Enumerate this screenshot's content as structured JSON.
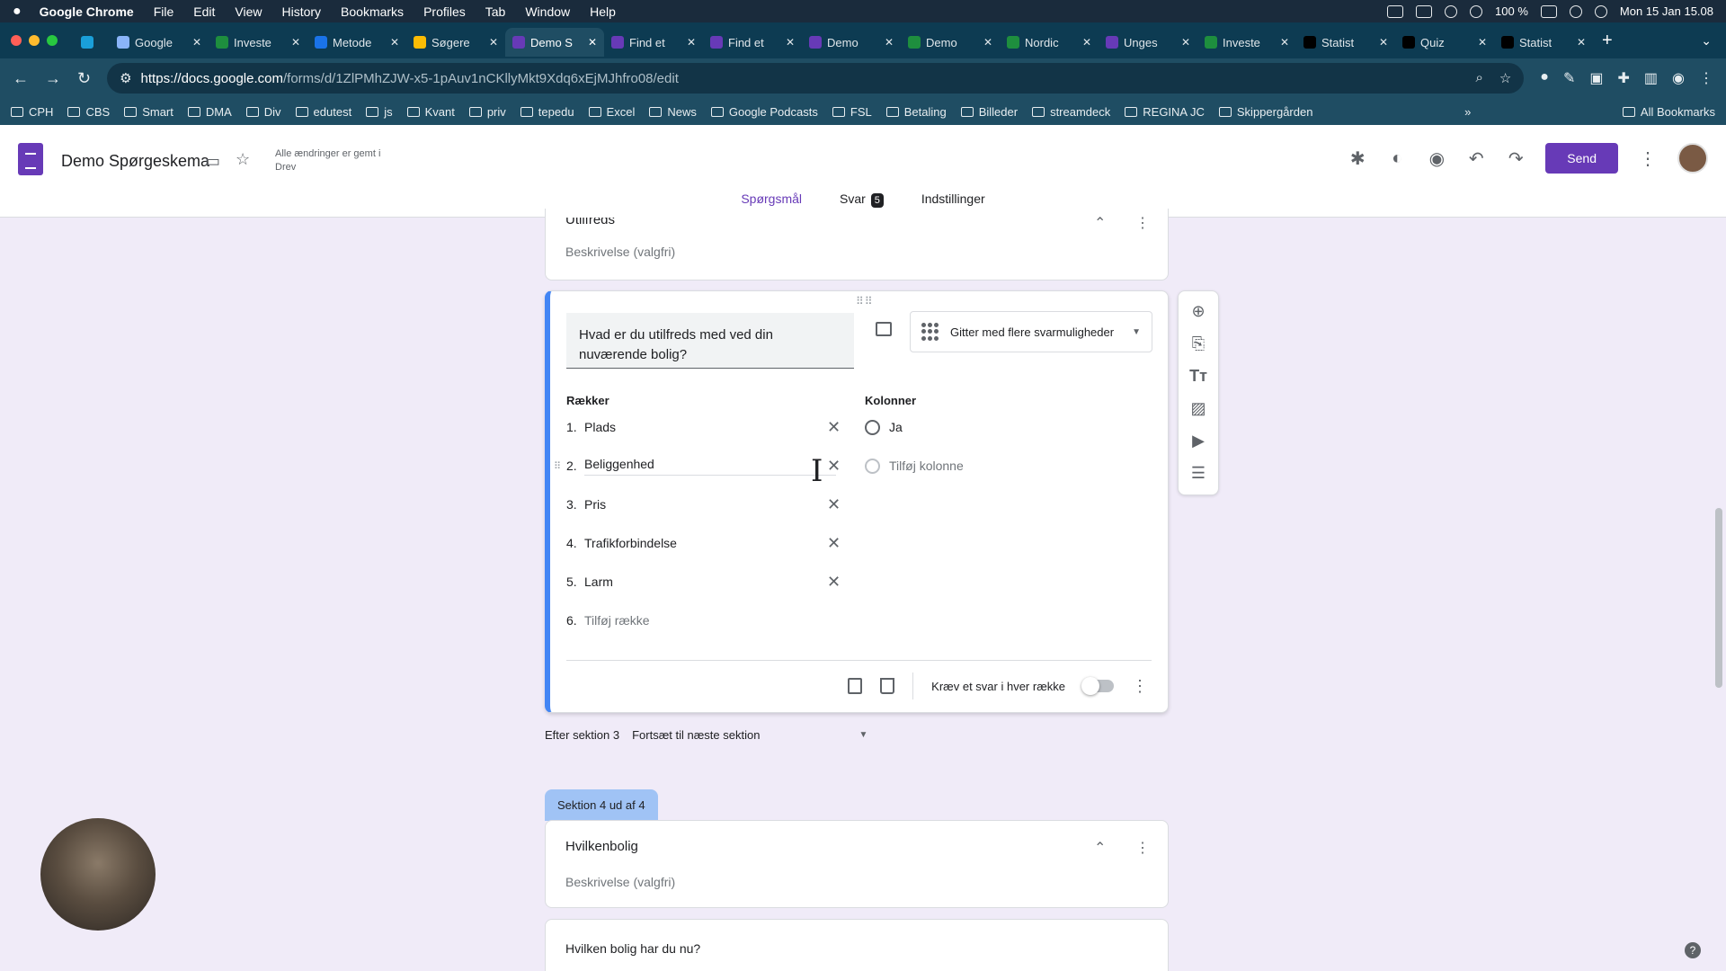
{
  "menubar": {
    "app": "Google Chrome",
    "items": [
      "File",
      "Edit",
      "View",
      "History",
      "Bookmarks",
      "Profiles",
      "Tab",
      "Window",
      "Help"
    ],
    "battery": "100 %",
    "clock": "Mon 15 Jan 15.08"
  },
  "tabs": [
    {
      "label": "Google",
      "color": "#8ab4f8"
    },
    {
      "label": "Investe",
      "color": "#1e8e3e"
    },
    {
      "label": "Metode",
      "color": "#1a73e8"
    },
    {
      "label": "Søgere",
      "color": "#fbbc04"
    },
    {
      "label": "Demo S",
      "color": "#673ab7",
      "active": true
    },
    {
      "label": "Find et",
      "color": "#673ab7"
    },
    {
      "label": "Find et",
      "color": "#673ab7"
    },
    {
      "label": "Demo",
      "color": "#673ab7"
    },
    {
      "label": "Demo",
      "color": "#1e8e3e"
    },
    {
      "label": "Nordic",
      "color": "#1e8e3e"
    },
    {
      "label": "Unges",
      "color": "#673ab7"
    },
    {
      "label": "Investe",
      "color": "#1e8e3e"
    },
    {
      "label": "Statist",
      "color": "#000000"
    },
    {
      "label": "Quiz",
      "color": "#000000"
    },
    {
      "label": "Statist",
      "color": "#000000"
    }
  ],
  "url": {
    "host": "https://docs.google.com",
    "path": "/forms/d/1ZlPMhZJW-x5-1pAuv1nCKllyMkt9Xdq6xEjMJhfro08/edit"
  },
  "bookmarks": [
    "CPH",
    "CBS",
    "Smart",
    "DMA",
    "Div",
    "edutest",
    "js",
    "Kvant",
    "priv",
    "tepedu",
    "Excel",
    "News",
    "Google Podcasts",
    "FSL",
    "Betaling",
    "Billeder",
    "streamdeck",
    "REGINA JC",
    "Skippergården"
  ],
  "all_bookmarks": "All Bookmarks",
  "form": {
    "title": "Demo Spørgeskema",
    "saved_status": "Alle ændringer er gemt i Drev",
    "send_label": "Send",
    "tabs": {
      "questions": "Spørgsmål",
      "responses": "Svar",
      "responses_count": "5",
      "settings": "Indstillinger"
    }
  },
  "prev_section": {
    "title": "Utilfreds",
    "description_placeholder": "Beskrivelse (valgfri)"
  },
  "question": {
    "title": "Hvad er du utilfreds med ved din nuværende bolig?",
    "type": "Gitter med flere svarmuligheder",
    "rows_header": "Rækker",
    "columns_header": "Kolonner",
    "rows": [
      {
        "num": "1.",
        "label": "Plads"
      },
      {
        "num": "2.",
        "label": "Beliggenhed"
      },
      {
        "num": "3.",
        "label": "Pris"
      },
      {
        "num": "4.",
        "label": "Trafikforbindelse"
      },
      {
        "num": "5.",
        "label": "Larm"
      }
    ],
    "add_row": {
      "num": "6.",
      "label": "Tilføj række"
    },
    "columns": [
      "Ja"
    ],
    "add_column": "Tilføj kolonne",
    "require_label": "Kræv et svar i hver række"
  },
  "after_section": {
    "label": "Efter sektion 3",
    "value": "Fortsæt til næste sektion"
  },
  "section4": {
    "tab": "Sektion 4 ud af 4",
    "title": "Hvilkenbolig",
    "description_placeholder": "Beskrivelse (valgfri)",
    "next_question": "Hvilken bolig har du nu?"
  },
  "icons": {
    "add_question": "add-circle-icon",
    "import": "import-icon",
    "title_text": "text-icon",
    "image": "image-icon",
    "video": "video-icon",
    "section": "section-icon"
  }
}
